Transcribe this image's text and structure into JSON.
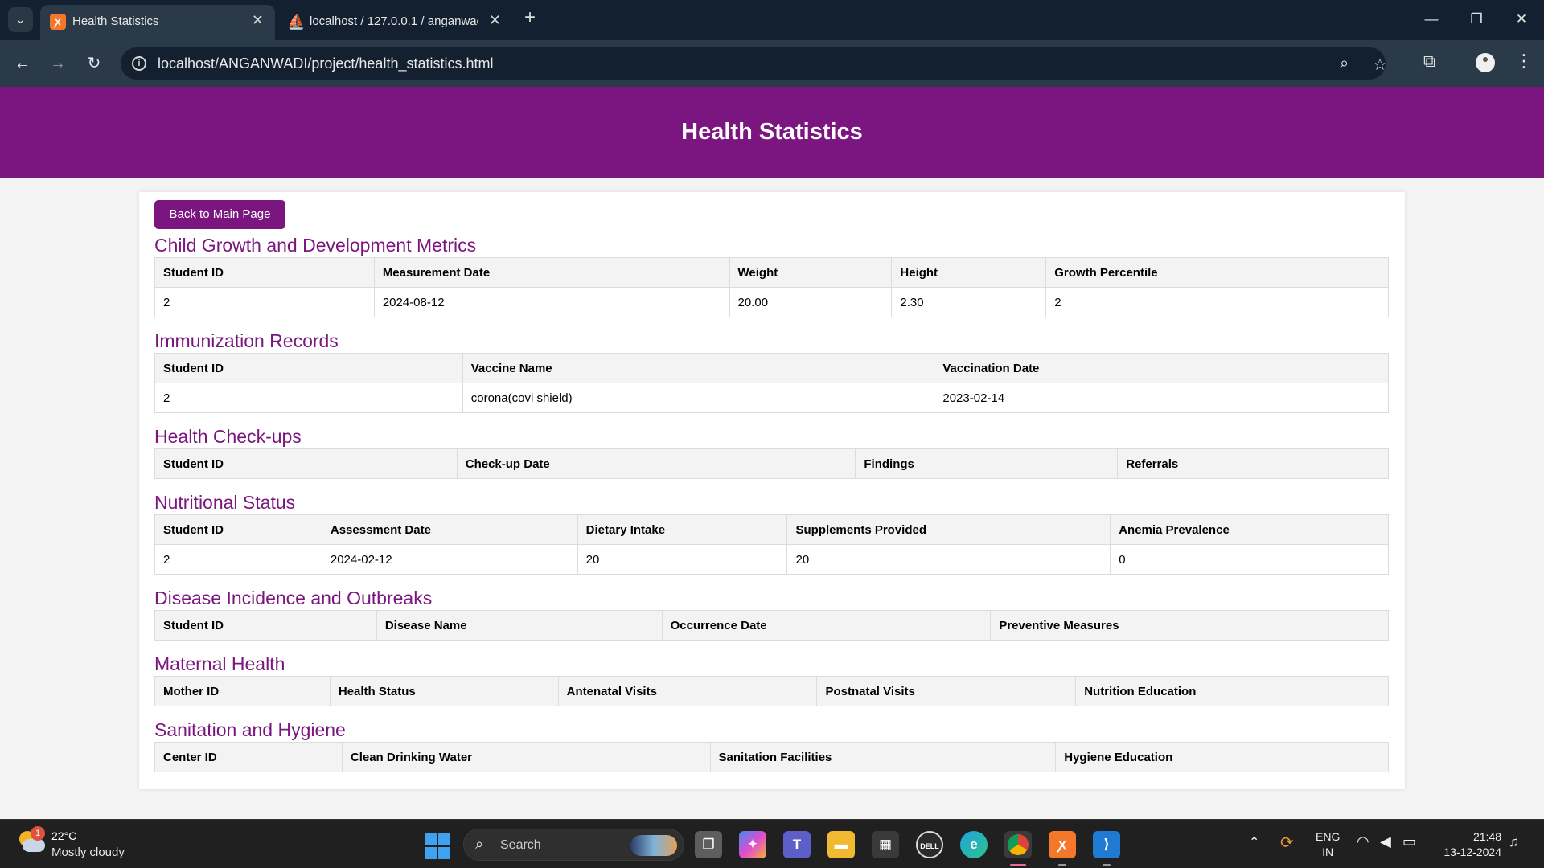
{
  "browser": {
    "tabs": [
      {
        "title": "Health Statistics",
        "active": true,
        "icon": "xampp-icon"
      },
      {
        "title": "localhost / 127.0.0.1 / anganwadi",
        "active": false,
        "icon": "phpmyadmin-icon"
      }
    ],
    "url": "localhost/ANGANWADI/project/health_statistics.html"
  },
  "page": {
    "title": "Health Statistics",
    "back_button": "Back to Main Page",
    "accent_color": "#7b157f"
  },
  "sections": {
    "growth": {
      "title": "Child Growth and Development Metrics",
      "columns": [
        "Student ID",
        "Measurement Date",
        "Weight",
        "Height",
        "Growth Percentile"
      ],
      "rows": [
        [
          "2",
          "2024-08-12",
          "20.00",
          "2.30",
          "2"
        ]
      ]
    },
    "immunization": {
      "title": "Immunization Records",
      "columns": [
        "Student ID",
        "Vaccine Name",
        "Vaccination Date"
      ],
      "rows": [
        [
          "2",
          "corona(covi shield)",
          "2023-02-14"
        ]
      ]
    },
    "checkups": {
      "title": "Health Check-ups",
      "columns": [
        "Student ID",
        "Check-up Date",
        "Findings",
        "Referrals"
      ],
      "rows": []
    },
    "nutrition": {
      "title": "Nutritional Status",
      "columns": [
        "Student ID",
        "Assessment Date",
        "Dietary Intake",
        "Supplements Provided",
        "Anemia Prevalence"
      ],
      "rows": [
        [
          "2",
          "2024-02-12",
          "20",
          "20",
          "0"
        ]
      ]
    },
    "disease": {
      "title": "Disease Incidence and Outbreaks",
      "columns": [
        "Student ID",
        "Disease Name",
        "Occurrence Date",
        "Preventive Measures"
      ],
      "rows": []
    },
    "maternal": {
      "title": "Maternal Health",
      "columns": [
        "Mother ID",
        "Health Status",
        "Antenatal Visits",
        "Postnatal Visits",
        "Nutrition Education"
      ],
      "rows": []
    },
    "sanitation": {
      "title": "Sanitation and Hygiene",
      "columns": [
        "Center ID",
        "Clean Drinking Water",
        "Sanitation Facilities",
        "Hygiene Education"
      ],
      "rows": []
    }
  },
  "taskbar": {
    "weather": {
      "temp": "22°C",
      "desc": "Mostly cloudy",
      "badge": "1"
    },
    "search_placeholder": "Search",
    "lang_top": "ENG",
    "lang_bottom": "IN",
    "time": "21:48",
    "date": "13-12-2024"
  }
}
